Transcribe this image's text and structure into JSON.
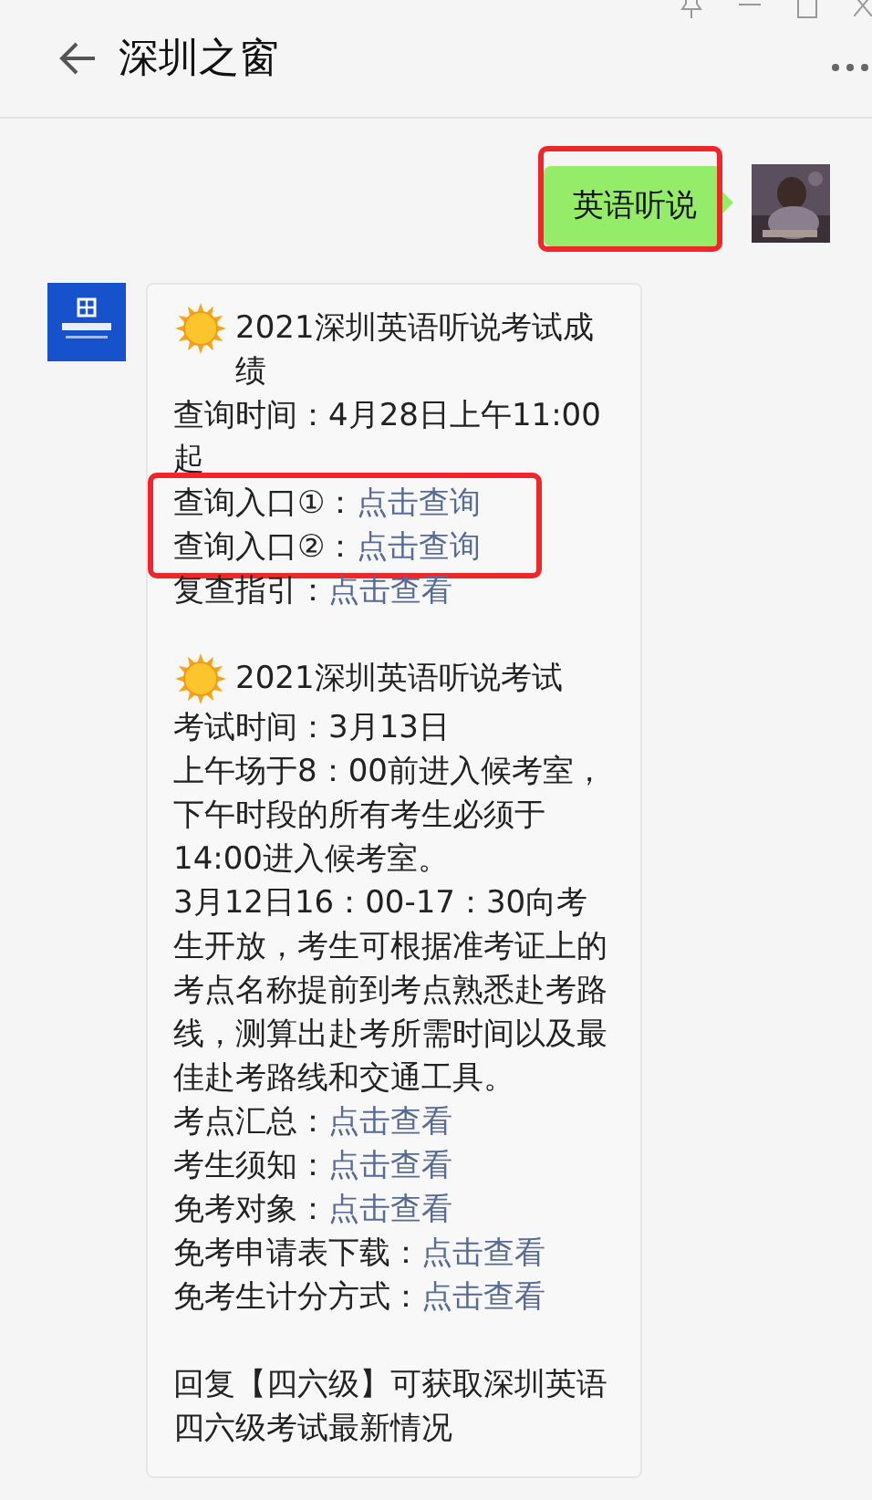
{
  "header": {
    "title": "深圳之窗"
  },
  "sent": {
    "text": "英语听说",
    "highlighted": true
  },
  "received": {
    "sections": [
      {
        "heading": "2021深圳英语听说考试成绩",
        "items": [
          {
            "kind": "text",
            "text": "查询时间：4月28日上午11:00起"
          },
          {
            "kind": "links",
            "highlighted": true,
            "rows": [
              {
                "label": "查询入口①：",
                "link": "点击查询"
              },
              {
                "label": "查询入口②：",
                "link": "点击查询"
              }
            ]
          },
          {
            "kind": "links",
            "highlighted": false,
            "rows": [
              {
                "label": "复查指引：",
                "link": "点击查看"
              }
            ]
          }
        ]
      },
      {
        "heading": "2021深圳英语听说考试",
        "items": [
          {
            "kind": "text",
            "text": "考试时间：3月13日"
          },
          {
            "kind": "text",
            "text": "上午场于8：00前进入候考室，下午时段的所有考生必须于14:00进入候考室。"
          },
          {
            "kind": "text",
            "text": "3月12日16：00-17：30向考生开放，考生可根据准考证上的考点名称提前到考点熟悉赴考路线，测算出赴考所需时间以及最佳赴考路线和交通工具。"
          },
          {
            "kind": "links",
            "highlighted": false,
            "rows": [
              {
                "label": "考点汇总：",
                "link": "点击查看"
              },
              {
                "label": "考生须知：",
                "link": "点击查看"
              },
              {
                "label": "免考对象：",
                "link": "点击查看"
              },
              {
                "label": "免考申请表下载：",
                "link": "点击查看"
              },
              {
                "label": "免考生计分方式：",
                "link": "点击查看"
              }
            ]
          }
        ]
      }
    ],
    "footer": "回复【四六级】可获取深圳英语四六级考试最新情况"
  }
}
